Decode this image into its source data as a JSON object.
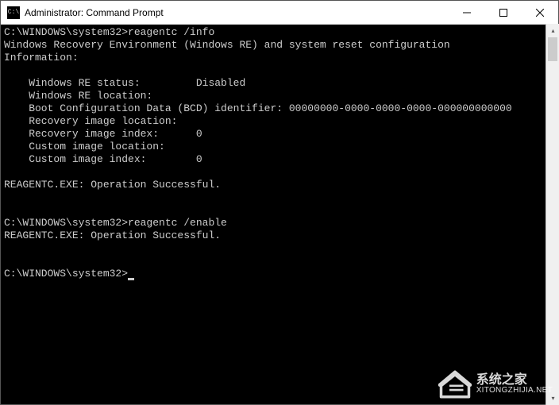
{
  "titlebar": {
    "icon_text": "C:\\",
    "title": "Administrator: Command Prompt"
  },
  "console": {
    "prompt": "C:\\WINDOWS\\system32>",
    "cmd1": "reagentc /info",
    "line2": "Windows Recovery Environment (Windows RE) and system reset configuration",
    "line3": "Information:",
    "row1_label": "    Windows RE status:         ",
    "row1_value": "Disabled",
    "row2": "    Windows RE location:",
    "row3_label": "    Boot Configuration Data (BCD) identifier: ",
    "row3_value": "00000000-0000-0000-0000-000000000000",
    "row4": "    Recovery image location:",
    "row5_label": "    Recovery image index:      ",
    "row5_value": "0",
    "row6": "    Custom image location:",
    "row7_label": "    Custom image index:        ",
    "row7_value": "0",
    "result": "REAGENTC.EXE: Operation Successful.",
    "cmd2": "reagentc /enable",
    "result2": "REAGENTC.EXE: Operation Successful."
  },
  "watermark": {
    "cn": "系统之家",
    "url": "XITONGZHIJIA.NET"
  }
}
